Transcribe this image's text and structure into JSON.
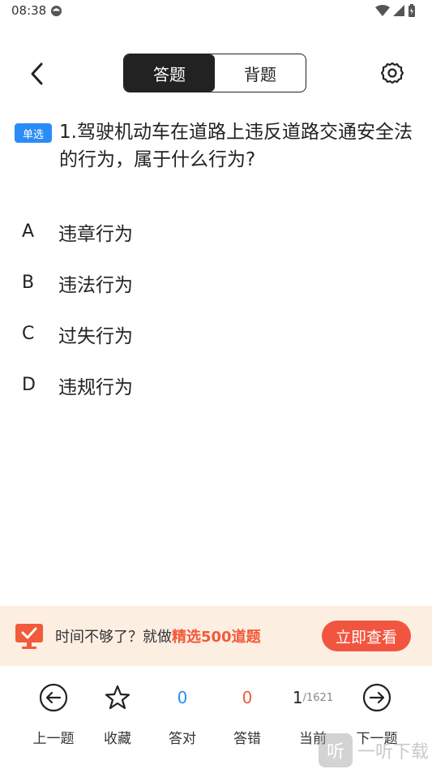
{
  "status": {
    "time": "08:38"
  },
  "nav": {
    "tabs": [
      {
        "label": "答题",
        "active": true
      },
      {
        "label": "背题",
        "active": false
      }
    ]
  },
  "question": {
    "type_badge": "单选",
    "text": "1.驾驶机动车在道路上违反道路交通安全法的行为，属于什么行为?"
  },
  "options": [
    {
      "letter": "A",
      "text": "违章行为"
    },
    {
      "letter": "B",
      "text": "违法行为"
    },
    {
      "letter": "C",
      "text": "过失行为"
    },
    {
      "letter": "D",
      "text": "违规行为"
    }
  ],
  "promo": {
    "text_prefix": "时间不够了？就做",
    "text_highlight": "精选500道题",
    "button": "立即查看"
  },
  "bottom": {
    "prev": "上一题",
    "favorite": "收藏",
    "correct_count": "0",
    "correct_label": "答对",
    "wrong_count": "0",
    "wrong_label": "答错",
    "current": "1",
    "total": "/1621",
    "current_label": "当前",
    "next": "下一题"
  },
  "watermark": {
    "logo": "听",
    "text": "一听下载"
  },
  "colors": {
    "accent_blue": "#2b8cf6",
    "accent_red": "#f15a3a",
    "promo_bg": "#fdeee2"
  }
}
